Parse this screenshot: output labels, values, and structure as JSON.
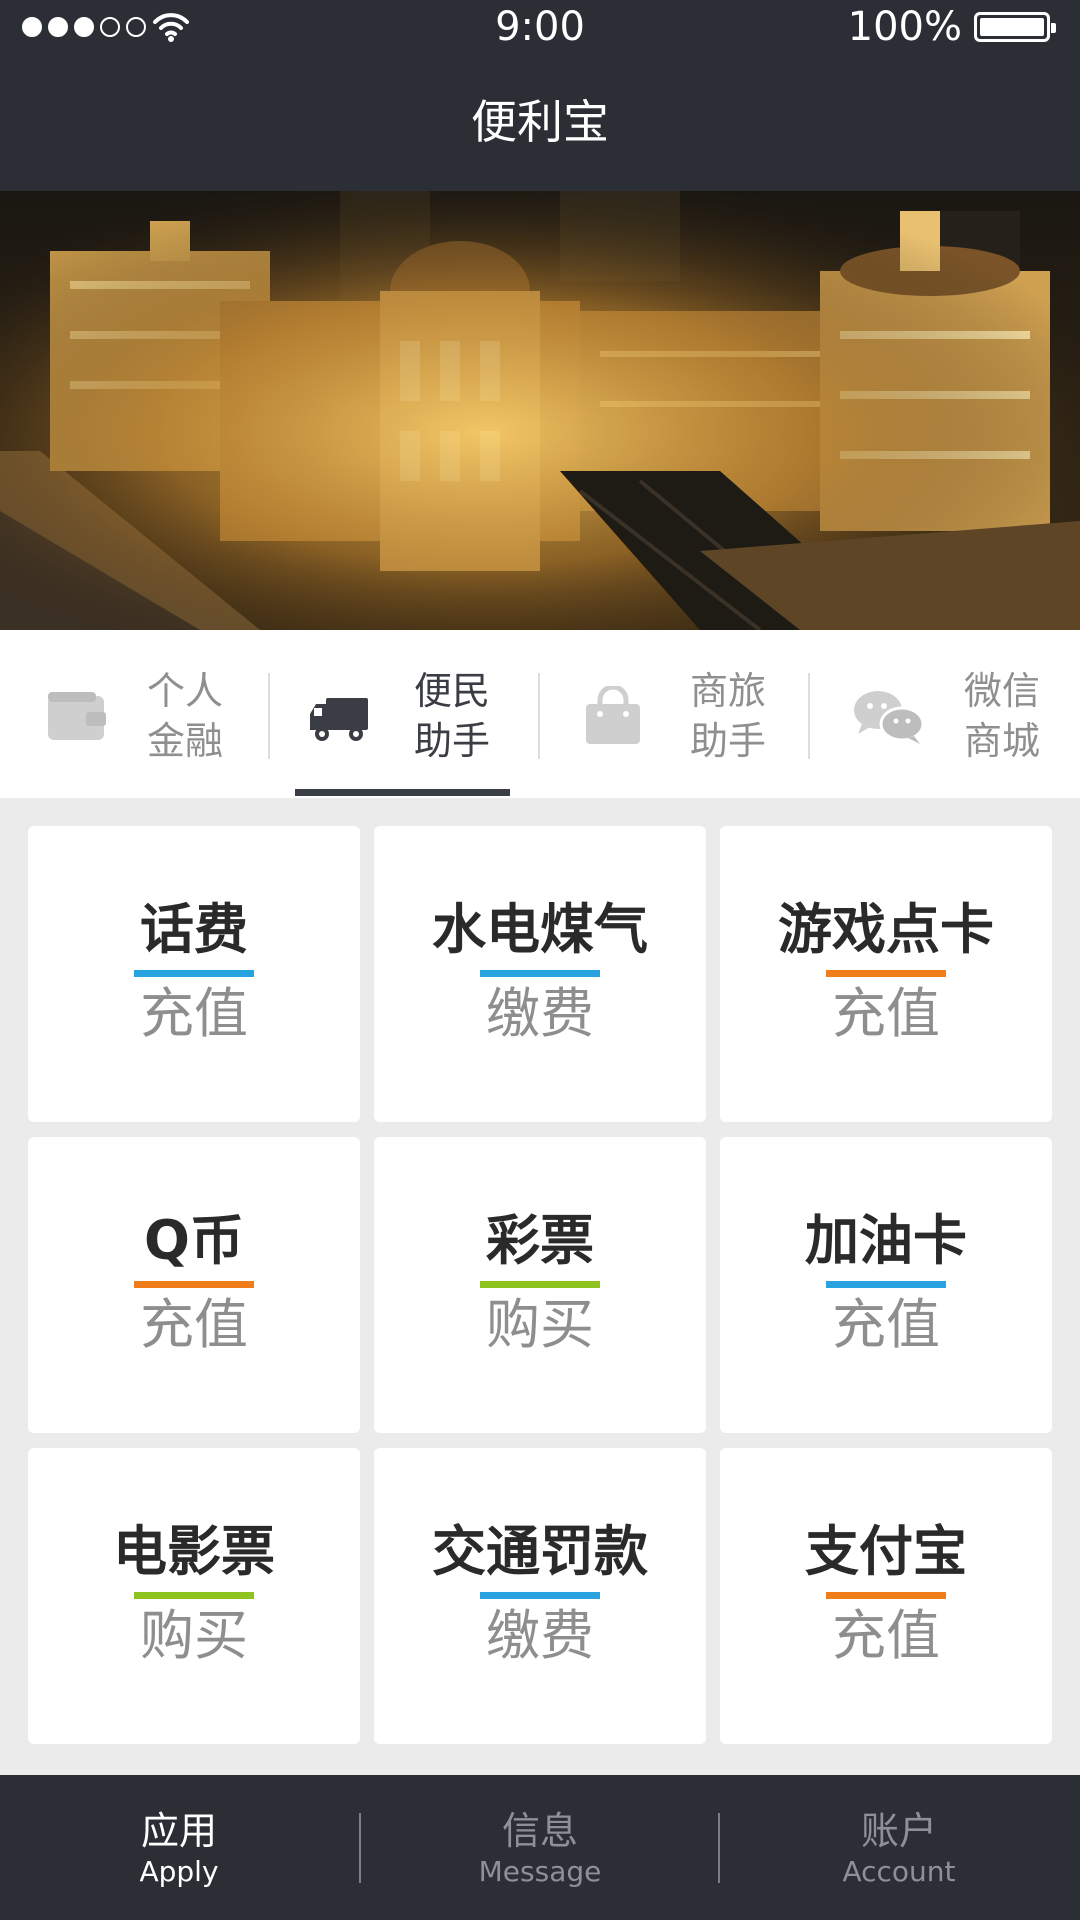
{
  "status_bar": {
    "time": "9:00",
    "battery": "100%",
    "signal_strength": 3
  },
  "header": {
    "title": "便利宝"
  },
  "categories": [
    {
      "line1": "个人",
      "line2": "金融",
      "icon": "wallet-icon",
      "active": false
    },
    {
      "line1": "便民",
      "line2": "助手",
      "icon": "truck-icon",
      "active": true
    },
    {
      "line1": "商旅",
      "line2": "助手",
      "icon": "shopping-bag-icon",
      "active": false
    },
    {
      "line1": "微信",
      "line2": "商城",
      "icon": "wechat-icon",
      "active": false
    }
  ],
  "services": [
    {
      "title": "话费",
      "action": "充值",
      "accent": "#29a3df"
    },
    {
      "title": "水电煤气",
      "action": "缴费",
      "accent": "#29a3df"
    },
    {
      "title": "游戏点卡",
      "action": "充值",
      "accent": "#f07d1c"
    },
    {
      "title": "Q币",
      "action": "充值",
      "accent": "#f07d1c"
    },
    {
      "title": "彩票",
      "action": "购买",
      "accent": "#8dc21f"
    },
    {
      "title": "加油卡",
      "action": "充值",
      "accent": "#29a3df"
    },
    {
      "title": "电影票",
      "action": "购买",
      "accent": "#8dc21f"
    },
    {
      "title": "交通罚款",
      "action": "缴费",
      "accent": "#29a3df"
    },
    {
      "title": "支付宝",
      "action": "充值",
      "accent": "#f07d1c"
    }
  ],
  "tabbar": [
    {
      "zh": "应用",
      "en": "Apply",
      "active": true
    },
    {
      "zh": "信息",
      "en": "Message",
      "active": false
    },
    {
      "zh": "账户",
      "en": "Account",
      "active": false
    }
  ],
  "colors": {
    "bar_bg": "#2b2e35",
    "page_bg": "#ebebeb",
    "active_text": "#3a3d44",
    "inactive_text": "#8f8f8f"
  }
}
